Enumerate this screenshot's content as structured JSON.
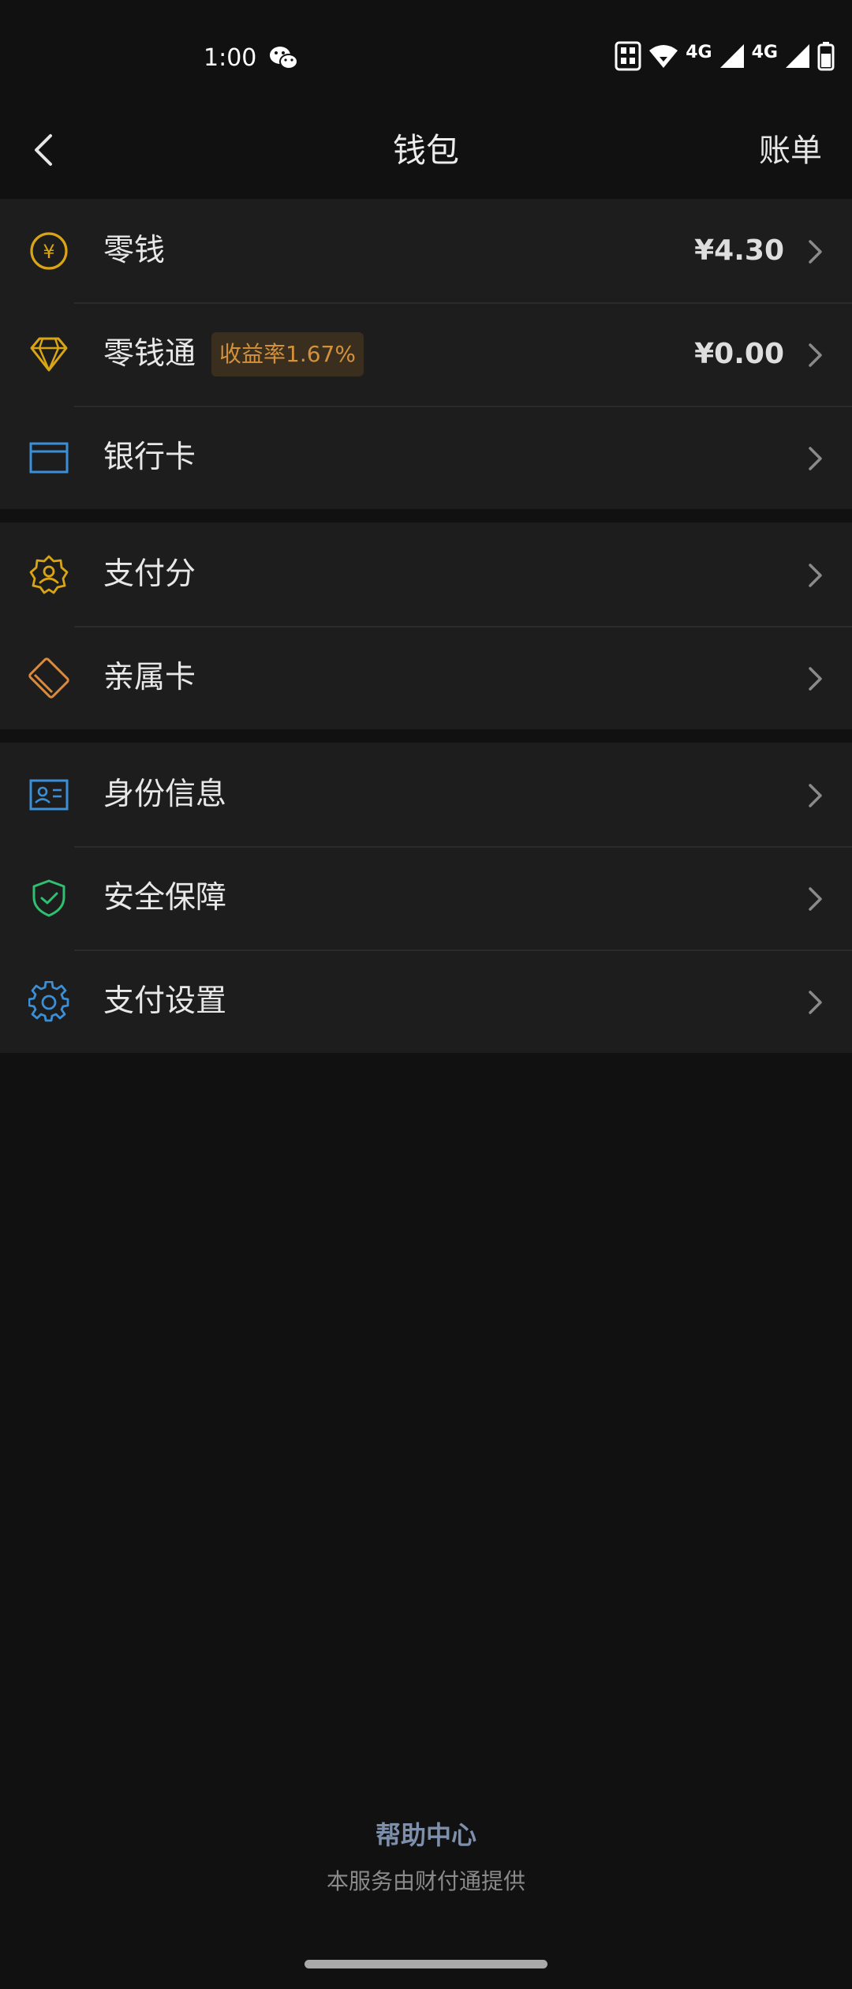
{
  "status_bar": {
    "time": "1:00",
    "network_1": "4G",
    "network_2": "4G"
  },
  "nav": {
    "title": "钱包",
    "right_action": "账单"
  },
  "groups": [
    {
      "items": [
        {
          "label": "零钱",
          "value": "¥4.30",
          "icon": "yuan-coin-icon",
          "icon_color": "#d9a514"
        },
        {
          "label": "零钱通",
          "badge": "收益率1.67%",
          "value": "¥0.00",
          "icon": "diamond-icon",
          "icon_color": "#d9a514"
        },
        {
          "label": "银行卡",
          "icon": "bank-card-icon",
          "icon_color": "#3b8fd6"
        }
      ]
    },
    {
      "items": [
        {
          "label": "支付分",
          "icon": "credit-score-icon",
          "icon_color": "#d9a514"
        },
        {
          "label": "亲属卡",
          "icon": "family-card-icon",
          "icon_color": "#d98a3c"
        }
      ]
    },
    {
      "items": [
        {
          "label": "身份信息",
          "icon": "id-card-icon",
          "icon_color": "#3b8fd6"
        },
        {
          "label": "安全保障",
          "icon": "shield-check-icon",
          "icon_color": "#2fbf71"
        },
        {
          "label": "支付设置",
          "icon": "gear-icon",
          "icon_color": "#3b8fd6"
        }
      ]
    }
  ],
  "footer": {
    "help_link": "帮助中心",
    "provider_note": "本服务由财付通提供"
  },
  "colors": {
    "background": "#111111",
    "row_background": "#1d1d1d",
    "badge_text": "#d4913c",
    "help_link": "#7d8fab"
  }
}
